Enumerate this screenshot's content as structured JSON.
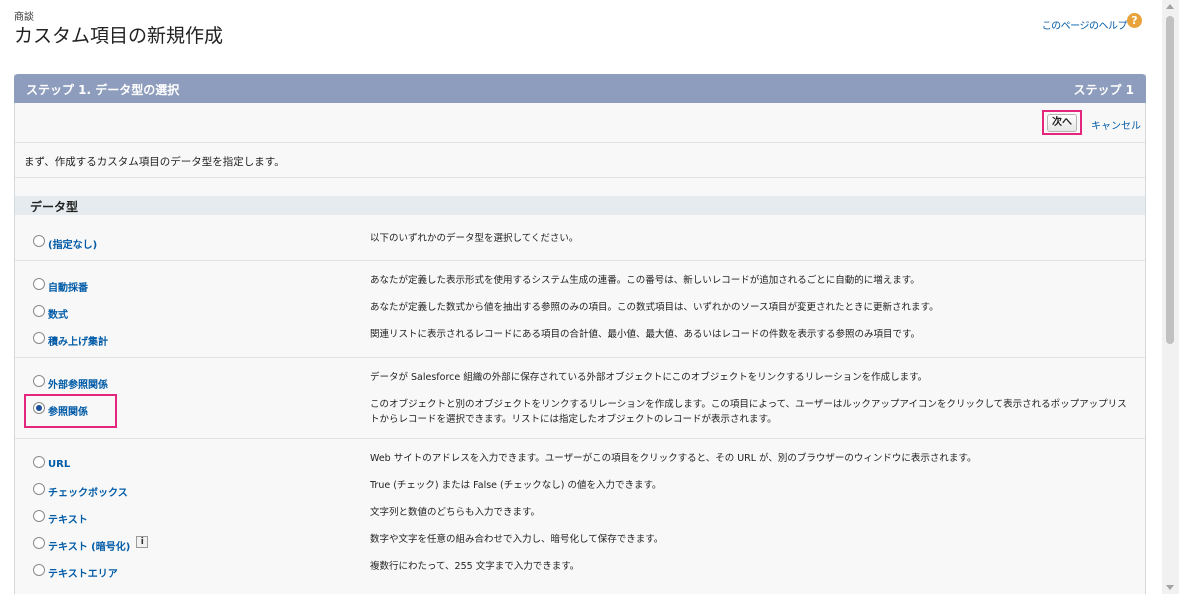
{
  "header": {
    "object_label": "商談",
    "title": "カスタム項目の新規作成",
    "help_link": "このページのヘルプ",
    "help_icon": "question-icon"
  },
  "step": {
    "title": "ステップ 1. データ型の選択",
    "indicator": "ステップ 1"
  },
  "buttons": {
    "next": "次へ",
    "cancel": "キャンセル"
  },
  "intro": "まず、作成するカスタム項目のデータ型を指定します。",
  "section_title": "データ型",
  "options": [
    {
      "label": "(指定なし)",
      "desc": "以下のいずれかのデータ型を選択してください。",
      "checked": false
    },
    {
      "label": "自動採番",
      "desc": "あなたが定義した表示形式を使用するシステム生成の連番。この番号は、新しいレコードが追加されるごとに自動的に増えます。",
      "checked": false
    },
    {
      "label": "数式",
      "desc": "あなたが定義した数式から値を抽出する参照のみの項目。この数式項目は、いずれかのソース項目が変更されたときに更新されます。",
      "checked": false
    },
    {
      "label": "積み上げ集計",
      "desc": "関連リストに表示されるレコードにある項目の合計値、最小値、最大値、あるいはレコードの件数を表示する参照のみ項目です。",
      "checked": false
    },
    {
      "label": "外部参照関係",
      "desc": "データが Salesforce 組織の外部に保存されている外部オブジェクトにこのオブジェクトをリンクするリレーションを作成します。",
      "checked": false
    },
    {
      "label": "参照関係",
      "desc": "このオブジェクトと別のオブジェクトをリンクするリレーションを作成します。この項目によって、ユーザーはルックアップアイコンをクリックして表示されるポップアップリストからレコードを選択できます。リストには指定したオブジェクトのレコードが表示されます。",
      "checked": true
    },
    {
      "label": "URL",
      "desc": "Web サイトのアドレスを入力できます。ユーザーがこの項目をクリックすると、その URL が、別のブラウザーのウィンドウに表示されます。",
      "checked": false
    },
    {
      "label": "チェックボックス",
      "desc": "True (チェック) または False (チェックなし) の値を入力できます。",
      "checked": false
    },
    {
      "label": "テキスト",
      "desc": "文字列と数値のどちらも入力できます。",
      "checked": false
    },
    {
      "label": "テキスト (暗号化)",
      "desc": "数字や文字を任意の組み合わせで入力し、暗号化して保存できます。",
      "checked": false,
      "info_icon": "i"
    },
    {
      "label": "テキストエリア",
      "desc": "複数行にわたって、255 文字まで入力できます。",
      "checked": false
    }
  ]
}
